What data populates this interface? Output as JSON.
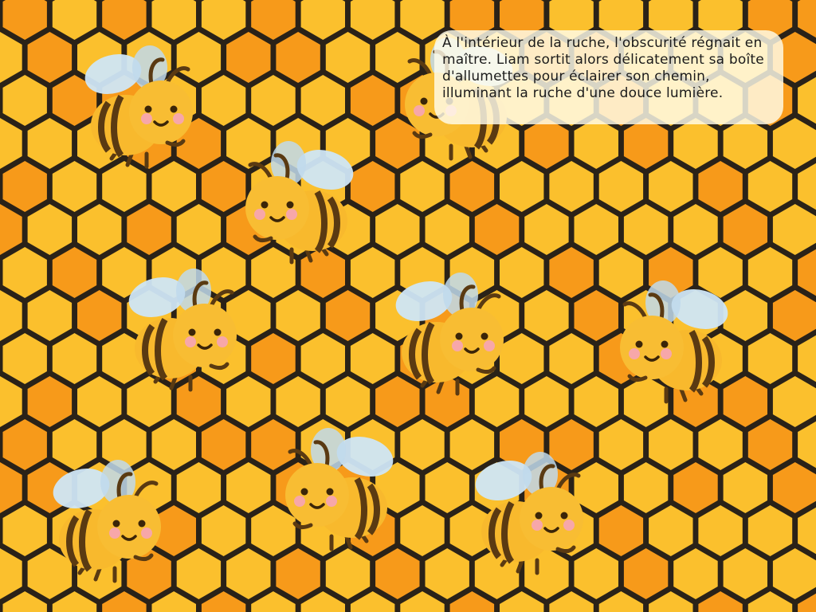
{
  "story": {
    "text": "À l'intérieur de la ruche, l'obscurité régnait en maître. Liam sortit alors délicatement sa boîte d'allumettes pour éclairer son chemin, illuminant la ruche d'une douce lumière."
  },
  "scene": {
    "background": "honeycomb",
    "colors": {
      "cell_light": "#FBC02D",
      "cell_dark": "#F79A1A",
      "gap": "#2a2218",
      "bee_body": "#F8B92D",
      "bee_stripe": "#5A3A12",
      "wing": "#CFE6F6",
      "cheek": "#F7A7A9"
    },
    "bees": [
      {
        "name": "bee-1",
        "flip": false
      },
      {
        "name": "bee-2",
        "flip": true
      },
      {
        "name": "bee-3",
        "flip": false
      },
      {
        "name": "bee-4",
        "flip": true
      },
      {
        "name": "bee-5",
        "flip": false
      },
      {
        "name": "bee-6",
        "flip": true
      },
      {
        "name": "bee-7",
        "flip": false
      },
      {
        "name": "bee-8",
        "flip": true
      },
      {
        "name": "bee-9",
        "flip": false
      }
    ]
  }
}
